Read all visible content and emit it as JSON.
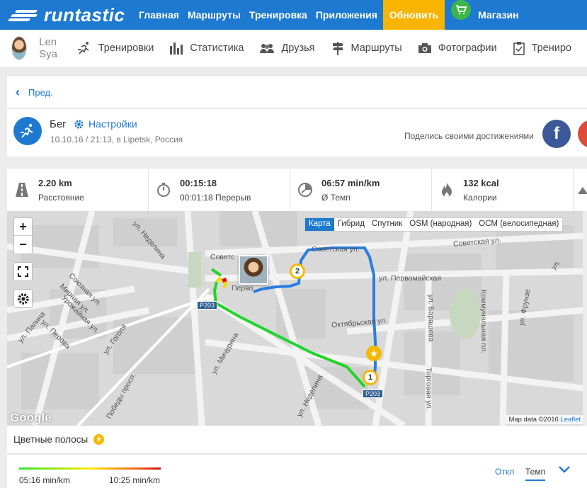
{
  "brand": {
    "logo_text": "runtastic"
  },
  "topnav": {
    "items": [
      {
        "label": "Главная"
      },
      {
        "label": "Маршруты"
      },
      {
        "label": "Тренировка"
      },
      {
        "label": "Приложения"
      }
    ],
    "update_label": "Обновить",
    "shop_label": "Магазин",
    "colors": {
      "bar": "#1e7ad0",
      "update": "#f7b500",
      "cart": "#3cb648"
    }
  },
  "subnav": {
    "user_name": "Len Sya",
    "items": [
      {
        "label": "Тренировки",
        "icon": "runner-icon"
      },
      {
        "label": "Статистика",
        "icon": "bar-chart-icon"
      },
      {
        "label": "Друзья",
        "icon": "friends-icon"
      },
      {
        "label": "Маршруты",
        "icon": "signpost-icon"
      },
      {
        "label": "Фотографии",
        "icon": "camera-icon"
      },
      {
        "label": "Трениро",
        "icon": "clipboard-icon"
      }
    ]
  },
  "prev": {
    "label": "Пред."
  },
  "activity": {
    "sport": "Бег",
    "settings_label": "Настройки",
    "meta": "10.10.16 / 21:13, в Lipetsk, Россия",
    "share_label": "Поделись своими достижениями",
    "facebook_glyph": "f"
  },
  "stats": [
    {
      "value": "2.20 km",
      "label": "Расстояние",
      "icon": "road-icon"
    },
    {
      "value": "00:15:18",
      "label": "00:01:18 Перерыв",
      "icon": "stopwatch-icon"
    },
    {
      "value": "06:57 min/km",
      "label": "Ø Темп",
      "icon": "pace-icon"
    },
    {
      "value": "132 kcal",
      "label": "Калории",
      "icon": "flame-icon"
    }
  ],
  "map": {
    "zoom_in": "+",
    "zoom_out": "−",
    "layers": [
      {
        "label": "Карта",
        "active": true
      },
      {
        "label": "Гибрид",
        "active": false
      },
      {
        "label": "Спутник",
        "active": false
      },
      {
        "label": "OSM (народная)",
        "active": false
      },
      {
        "label": "ОСМ (велосипедная)",
        "active": false
      }
    ],
    "google": "Google",
    "attribution": "Map data ©2016",
    "leaflet": "Leaflet",
    "markers": {
      "one": "1",
      "two": "2",
      "star": "★"
    },
    "labels": {
      "nedelina_top": "ул. Неделина",
      "sovetskaya_left": "Советс",
      "sovetskaya_top": "Советская ул.",
      "sovetskaya_right": "Советская ул.",
      "pervomayskaya": "ул. Первомайская",
      "pervo": "Перво",
      "soyuznaya": "Союзная ул.",
      "mirnaya": "Мирная ул.",
      "urozhaynaya": "Урожайная ул.",
      "papina": "ул. Папина",
      "perova": "ул. Перова",
      "gogolya": "ул. Гоголя",
      "michurina": "ул. Мичурина",
      "pobedy": "Победы просп.",
      "nedelina_bottom": "ул. Неделина",
      "oktyabrskaya": "Октябрьская ул.",
      "barasheva": "ул. Барашева",
      "torgovaya": "Торговая ул.",
      "kommunalnaya": "Коммунальная пл.",
      "frunze": "ул. Фрунзе",
      "vtoraya": "ул.",
      "road_badge_left": "Р203",
      "road_badge_right": "Р203"
    }
  },
  "colorbars": {
    "title": "Цветные полосы",
    "star_glyph": "★",
    "min_label": "05:16 min/km",
    "max_label": "10:25 min/km",
    "link_label": "Откл",
    "tab_label": "Темп"
  }
}
